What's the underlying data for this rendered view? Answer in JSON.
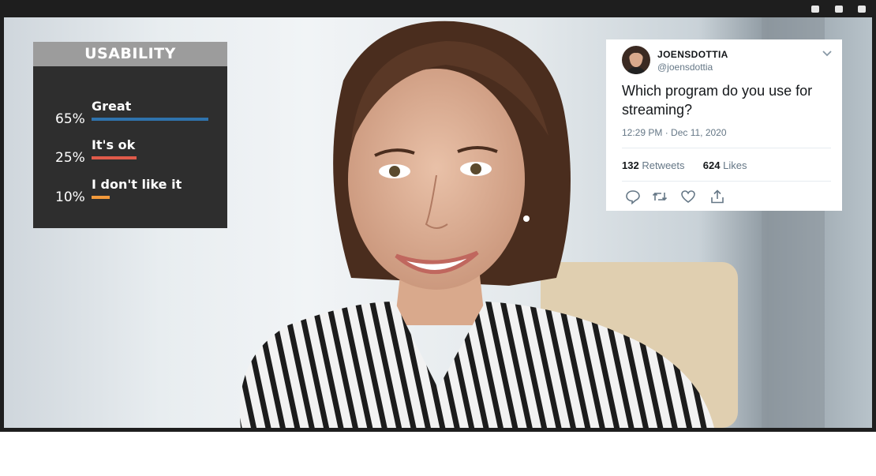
{
  "window": {
    "controls": [
      "minimize-icon",
      "maximize-icon",
      "close-icon"
    ]
  },
  "poll": {
    "title": "USABILITY",
    "rows": [
      {
        "percent": "65%",
        "label": "Great",
        "value": 0.65,
        "color": "#2f73ad"
      },
      {
        "percent": "25%",
        "label": "It's ok",
        "value": 0.25,
        "color": "#e05a4a"
      },
      {
        "percent": "10%",
        "label": "I don't like it",
        "value": 0.1,
        "color": "#f39a3b"
      }
    ]
  },
  "tweet": {
    "display_name": "JOENSDOTTIA",
    "handle": "@joensdottia",
    "text": "Which program do you use for streaming?",
    "timestamp": "12:29 PM · Dec 11, 2020",
    "retweets": "132",
    "retweets_label": "Retweets",
    "likes": "624",
    "likes_label": "Likes",
    "actions": [
      "reply-icon",
      "retweet-icon",
      "like-icon",
      "share-icon"
    ]
  }
}
